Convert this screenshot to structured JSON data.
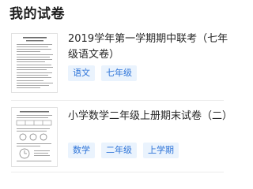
{
  "section": {
    "title": "我的试卷"
  },
  "papers": [
    {
      "title": "2019学年第一学期期中联考（七年级语文卷）",
      "tags": [
        "语文",
        "七年级"
      ]
    },
    {
      "title": "小学数学二年级上册期末试卷（二）",
      "tags": [
        "数学",
        "二年级",
        "上学期"
      ]
    }
  ],
  "colors": {
    "tag_text": "#2e74d8",
    "tag_bg": "#eaf3fd",
    "title_text": "#262626",
    "divider": "#ececec"
  }
}
